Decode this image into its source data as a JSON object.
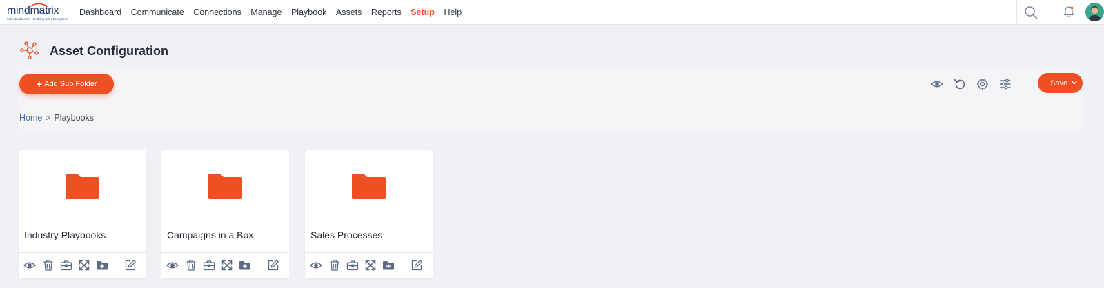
{
  "brand": {
    "logo_text": "mindmatrix",
    "tagline": "Sales Enablement · Enabling Sales Ecosystems"
  },
  "nav": {
    "items": [
      {
        "label": "Dashboard"
      },
      {
        "label": "Communicate"
      },
      {
        "label": "Connections"
      },
      {
        "label": "Manage"
      },
      {
        "label": "Playbook"
      },
      {
        "label": "Assets"
      },
      {
        "label": "Reports"
      },
      {
        "label": "Setup",
        "active": true
      },
      {
        "label": "Help"
      }
    ],
    "icons": [
      "search-icon",
      "bell-icon",
      "avatar"
    ]
  },
  "page": {
    "title": "Asset Configuration",
    "icon": "network-icon"
  },
  "toolbar": {
    "add_label": "Add Sub Folder",
    "save_label": "Save",
    "icons": [
      "eye-icon",
      "undo-icon",
      "gear-icon",
      "sliders-icon",
      "chevron-down-icon"
    ]
  },
  "breadcrumb": {
    "home": "Home",
    "separator": ">",
    "current": "Playbooks"
  },
  "folders": [
    {
      "name": "Industry Playbooks"
    },
    {
      "name": "Campaigns in a Box"
    },
    {
      "name": "Sales Processes"
    }
  ],
  "card_action_icons": [
    "eye-icon",
    "trash-icon",
    "briefcase-icon",
    "expand-icon",
    "folder-plus-icon",
    "edit-icon"
  ],
  "colors": {
    "accent": "#ee5024",
    "active_nav": "#ec4e20",
    "link": "#3f6fa8",
    "icon_gray": "#5b6b85"
  }
}
